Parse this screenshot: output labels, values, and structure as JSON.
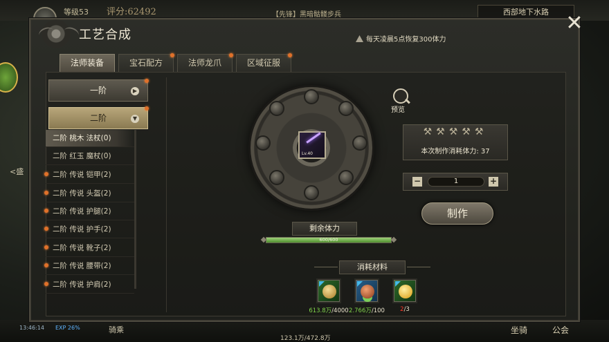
{
  "hud": {
    "level": "等级53",
    "score": "评分:62492",
    "quest": "【先锋】黑暗骷髅步兵",
    "map": "西部地下水路",
    "left_text": "<盛",
    "time": "13:46:14",
    "exp": "EXP 26%",
    "mount_label": "骑乘",
    "money": "123.1万/472.8万",
    "ride_button": "坐骑",
    "guild_button": "公会"
  },
  "panel": {
    "title": "工艺合成",
    "notice": "每天凌晨5点恢复300体力",
    "close_glyph": "✕"
  },
  "tabs": [
    {
      "label": "法师装备",
      "active": true
    },
    {
      "label": "宝石配方",
      "active": false
    },
    {
      "label": "法师龙爪",
      "active": false
    },
    {
      "label": "区域征服",
      "active": false
    }
  ],
  "tiers": [
    {
      "label": "一阶",
      "arrow": "▶"
    },
    {
      "label": "二阶",
      "arrow": "▼"
    }
  ],
  "recipes": [
    {
      "label": "二阶 桃木 法杖(0)",
      "selected": true,
      "dot": false
    },
    {
      "label": "二阶 红玉 魔杖(0)",
      "selected": false,
      "dot": false
    },
    {
      "label": "二阶 传说 铠甲(2)",
      "selected": false,
      "dot": true
    },
    {
      "label": "二阶 传说 头盔(2)",
      "selected": false,
      "dot": true
    },
    {
      "label": "二阶 传说 护腿(2)",
      "selected": false,
      "dot": true
    },
    {
      "label": "二阶 传说 护手(2)",
      "selected": false,
      "dot": true
    },
    {
      "label": "二阶 传说 靴子(2)",
      "selected": false,
      "dot": true
    },
    {
      "label": "二阶 传说 腰带(2)",
      "selected": false,
      "dot": true
    },
    {
      "label": "二阶 传说 护肩(2)",
      "selected": false,
      "dot": true
    }
  ],
  "crafting": {
    "item_level": "Lv.40",
    "preview_label": "预览",
    "tools_icons": "⚒⚒⚒⚒⚒",
    "cost_text": "本次制作消耗体力: 37",
    "quantity": "1",
    "minus": "−",
    "plus": "+",
    "craft_button": "制作"
  },
  "stamina": {
    "label": "剩余体力",
    "text": "600/600",
    "fraction": 1.0
  },
  "materials": {
    "header": "消耗材料",
    "items": [
      {
        "have": "613.8万",
        "need": "/4000",
        "enough": true,
        "color": "#d9b25a"
      },
      {
        "have": "2.766万",
        "need": "/100",
        "enough": true,
        "color": "#c8622a"
      },
      {
        "have": "2",
        "need": "/3",
        "enough": false,
        "color": "#f0c030"
      }
    ]
  },
  "colors": {
    "accent": "#e0712a",
    "stamina_green": "#7fd24a",
    "lack_red": "#ff3a2a"
  }
}
